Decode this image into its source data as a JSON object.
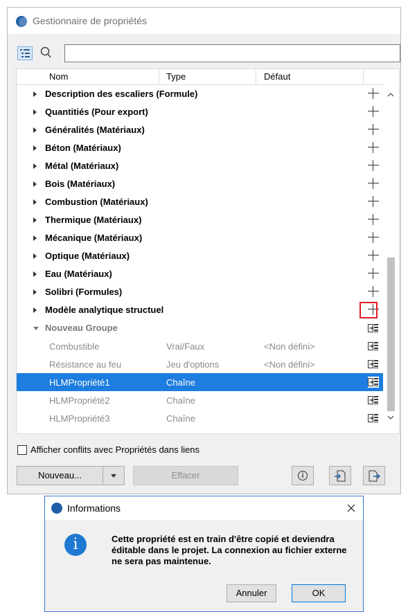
{
  "window": {
    "title": "Gestionnaire de propriétés"
  },
  "search": {
    "value": "",
    "placeholder": ""
  },
  "columns": {
    "name": "Nom",
    "type": "Type",
    "default": "Défaut"
  },
  "groups": [
    {
      "label": "Description des escaliers (Formule)"
    },
    {
      "label": "Quantitiés (Pour export)"
    },
    {
      "label": "Généralités (Matériaux)"
    },
    {
      "label": "Béton (Matériaux)"
    },
    {
      "label": "Métal (Matériaux)"
    },
    {
      "label": "Bois (Matériaux)"
    },
    {
      "label": "Combustion (Matériaux)"
    },
    {
      "label": "Thermique (Matériaux)"
    },
    {
      "label": "Mécanique (Matériaux)"
    },
    {
      "label": "Optique (Matériaux)"
    },
    {
      "label": "Eau (Matériaux)"
    },
    {
      "label": "Solibri (Formules)"
    },
    {
      "label": "Modèle analytique structuel"
    }
  ],
  "expanded_group": {
    "label": "Nouveau Groupe",
    "properties": [
      {
        "name": "Combustible",
        "type": "Vrai/Faux",
        "default": "<Non défini>",
        "selected": false
      },
      {
        "name": "Résistance au feu",
        "type": "Jeu d'options",
        "default": "<Non défini>",
        "selected": false
      },
      {
        "name": "HLMPropriété1",
        "type": "Chaîne",
        "default": "",
        "selected": true
      },
      {
        "name": "HLMPropriété2",
        "type": "Chaîne",
        "default": "",
        "selected": false
      },
      {
        "name": "HLMPropriété3",
        "type": "Chaîne",
        "default": "",
        "selected": false
      }
    ]
  },
  "options": {
    "show_conflicts_label": "Afficher conflits avec Propriétés dans liens",
    "show_conflicts_checked": false
  },
  "buttons": {
    "new": "Nouveau...",
    "delete": "Effacer"
  },
  "icons": {
    "app": "archicad-logo-icon",
    "tree": "tree-view-icon",
    "search": "search-icon",
    "add": "plus-icon",
    "linked": "linked-property-icon",
    "info": "info-icon",
    "import": "import-icon",
    "export": "export-icon",
    "close": "close-icon"
  },
  "colors": {
    "selection": "#1e7de0",
    "highlight": "#e01b24",
    "info": "#1f78d1"
  },
  "dialog": {
    "title": "Informations",
    "message": "Cette propriété est en train d'être copié et deviendra éditable dans le projet. La connexion au fichier externe ne sera pas maintenue.",
    "cancel": "Annuler",
    "ok": "OK"
  }
}
